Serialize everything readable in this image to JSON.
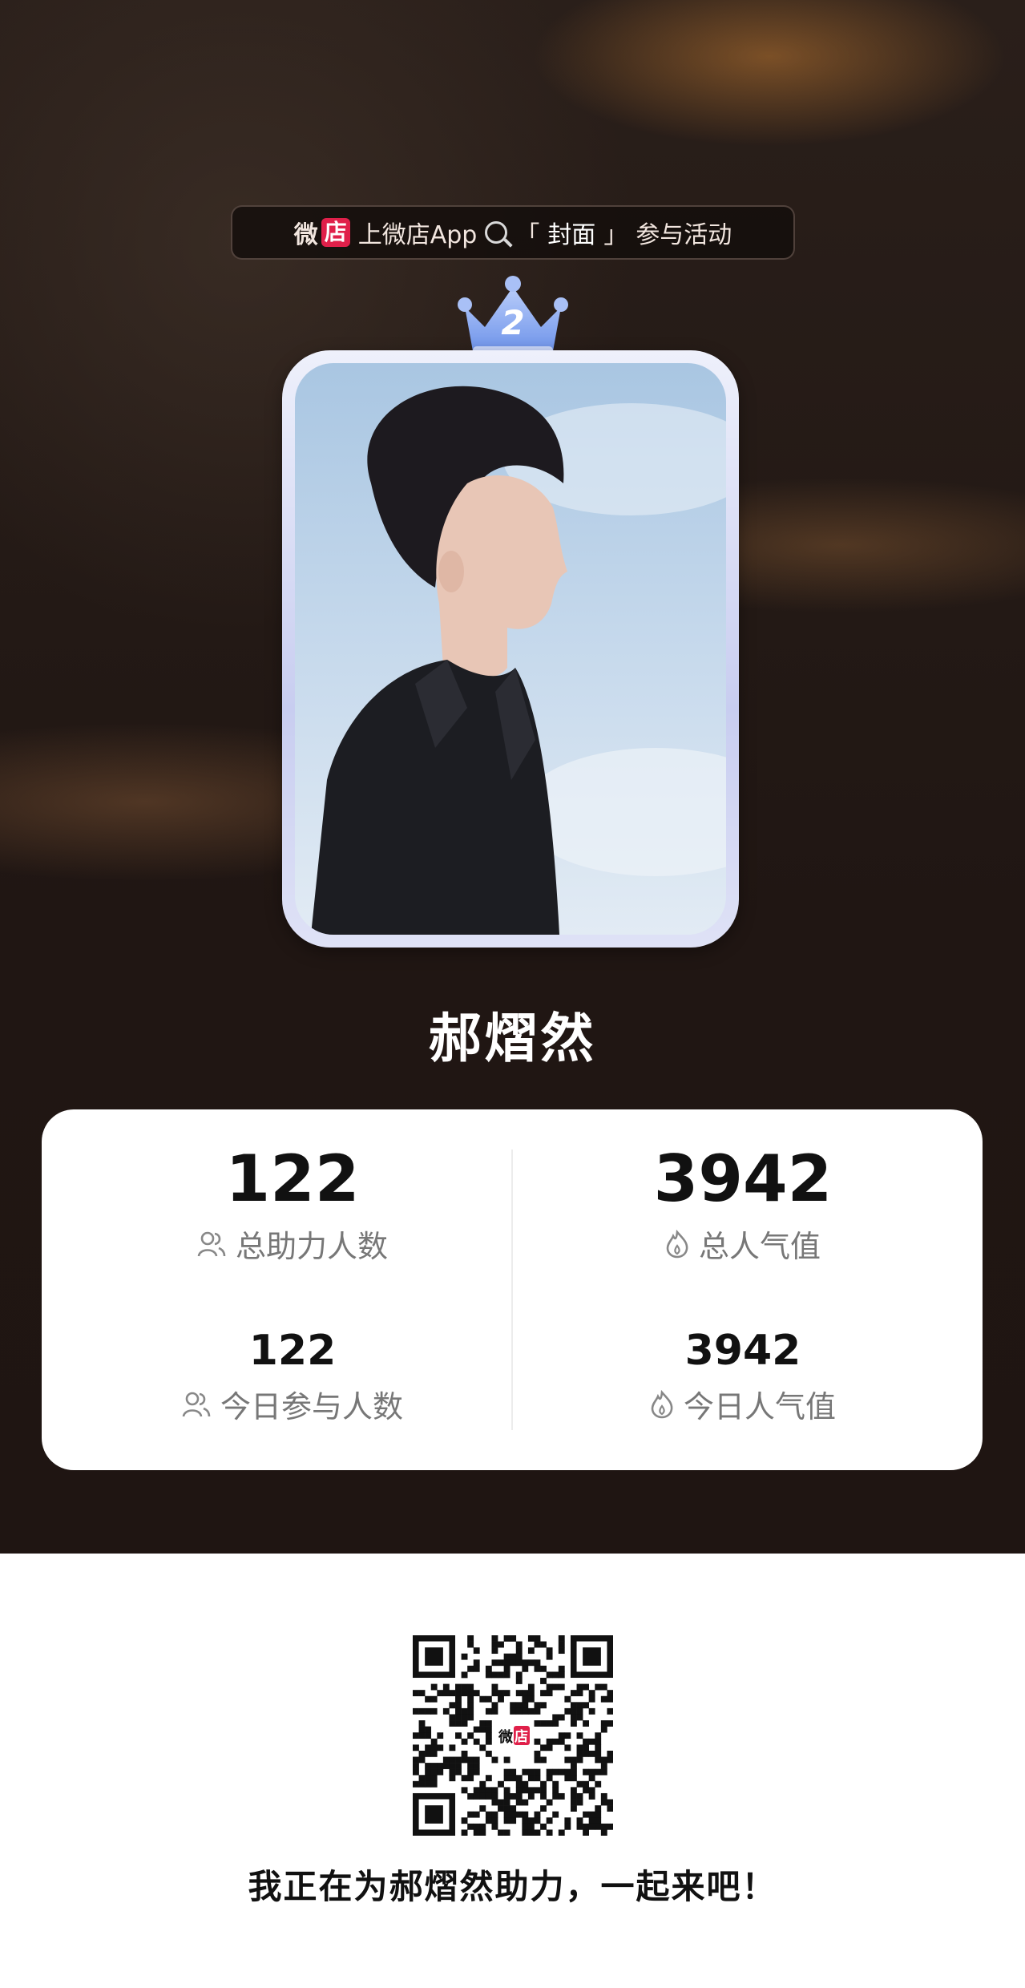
{
  "banner": {
    "brand_wei": "微",
    "brand_store": "店",
    "prefix": "上微店App",
    "search_icon": "search-icon",
    "bracket_open": "「",
    "keyword": "封面",
    "bracket_close": "」",
    "suffix": "参与活动"
  },
  "rank": {
    "number": "2",
    "icon": "crown-icon",
    "color": "#8fb0f0"
  },
  "profile": {
    "name": "郝熠然",
    "photo": "portrait-photo"
  },
  "stats": {
    "total_supporters": {
      "value": "122",
      "label": "总助力人数",
      "icon": "users-icon"
    },
    "total_popularity": {
      "value": "3942",
      "label": "总人气值",
      "icon": "flame-icon"
    },
    "today_participants": {
      "value": "122",
      "label": "今日参与人数",
      "icon": "users-icon"
    },
    "today_popularity": {
      "value": "3942",
      "label": "今日人气值",
      "icon": "flame-icon"
    }
  },
  "share": {
    "qr_logo_wei": "微",
    "qr_logo_store": "店",
    "text": "我正在为郝熠然助力，一起来吧！"
  },
  "colors": {
    "brand_red": "#e0204a",
    "poster_bg": "#231915"
  }
}
